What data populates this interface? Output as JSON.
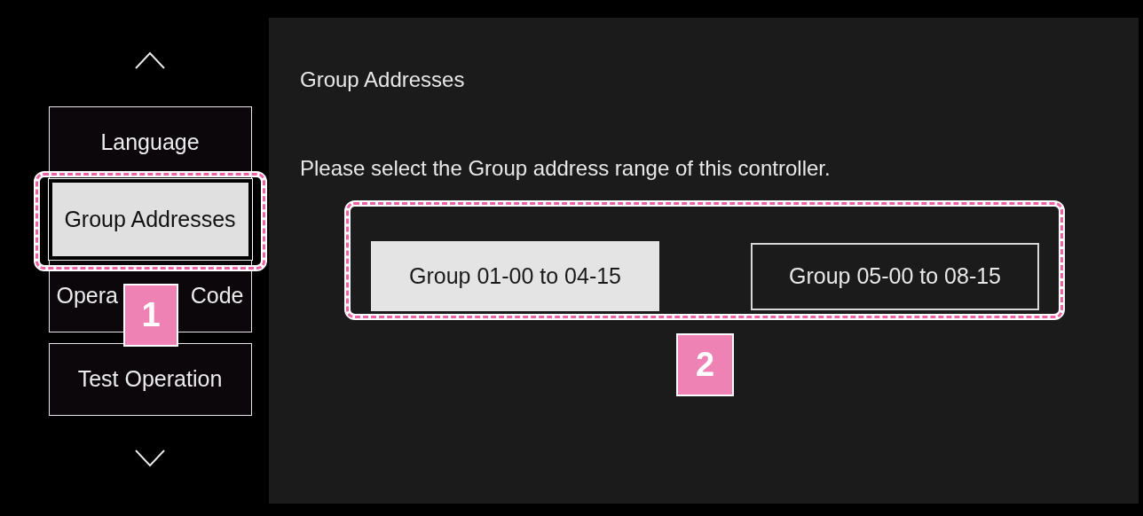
{
  "sidebar": {
    "items": [
      {
        "texts": [
          "Language"
        ],
        "selected": false
      },
      {
        "texts": [
          "Group Addresses"
        ],
        "selected": true
      },
      {
        "texts": [
          "Opera",
          "Code"
        ],
        "selected": false
      },
      {
        "texts": [
          "Test Operation"
        ],
        "selected": false
      }
    ]
  },
  "panel": {
    "title": "Group Addresses",
    "instruction": "Please select the Group address range of this controller.",
    "options": [
      {
        "label": "Group 01-00 to 04-15",
        "selected": true
      },
      {
        "label": "Group 05-00 to 08-15",
        "selected": false
      }
    ]
  },
  "annotations": [
    {
      "label": "1"
    },
    {
      "label": "2"
    }
  ]
}
